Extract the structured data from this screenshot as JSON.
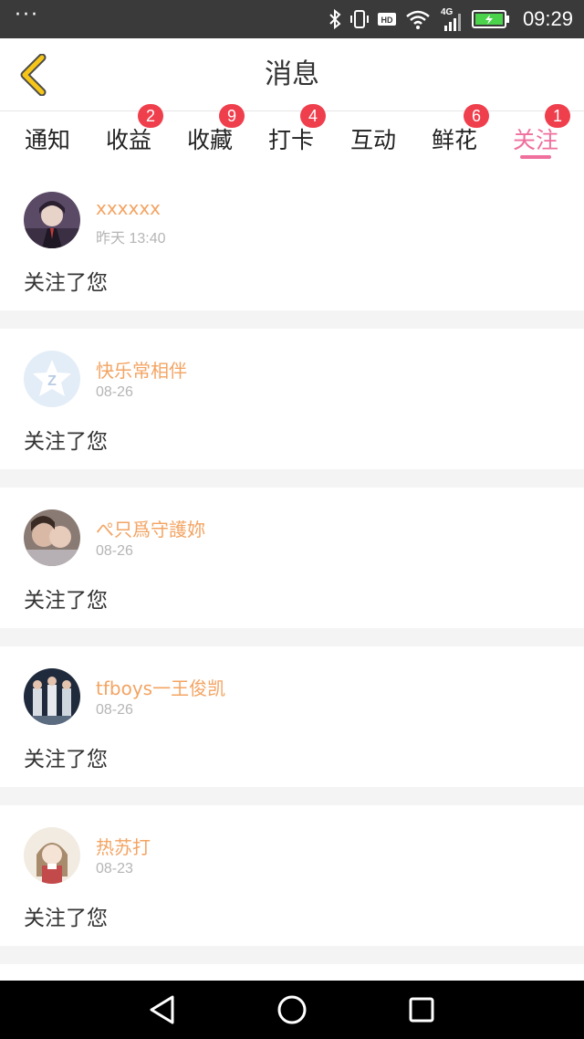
{
  "status_bar": {
    "left_icon": "more-dots-icon",
    "left_glyph": "···",
    "icons": [
      "bluetooth-icon",
      "vibrate-icon",
      "hd-icon",
      "wifi-icon",
      "signal-4g-icon",
      "battery-charging-icon"
    ],
    "network_label": "4G",
    "hd_label": "HD",
    "time": "09:29"
  },
  "header": {
    "title": "消息",
    "back_icon": "chevron-left-icon",
    "accent_color": "#f5c518"
  },
  "tabs": [
    {
      "label": "通知",
      "badge": ""
    },
    {
      "label": "收益",
      "badge": "2"
    },
    {
      "label": "收藏",
      "badge": "9"
    },
    {
      "label": "打卡",
      "badge": "4"
    },
    {
      "label": "互动",
      "badge": ""
    },
    {
      "label": "鲜花",
      "badge": "6"
    },
    {
      "label": "关注",
      "badge": "1",
      "active": true
    }
  ],
  "colors": {
    "active_tab": "#ef6f9d",
    "badge": "#ef3e4c",
    "username": "#f3a463",
    "timestamp": "#b5b5b5"
  },
  "notifications": [
    {
      "username": "xxxxxx",
      "time": "昨天 13:40",
      "message": "关注了您",
      "avatar": "anime-boy-avatar"
    },
    {
      "username": "快乐常相伴",
      "time": "08-26",
      "message": "关注了您",
      "avatar": "qq-default-avatar"
    },
    {
      "username": "ぺ只爲守護妳",
      "time": "08-26",
      "message": "关注了您",
      "avatar": "couple-photo-avatar"
    },
    {
      "username": "tfboys一王俊凯",
      "time": "08-26",
      "message": "关注了您",
      "avatar": "group-photo-avatar"
    },
    {
      "username": "热苏打",
      "time": "08-23",
      "message": "关注了您",
      "avatar": "anime-girl-avatar"
    }
  ],
  "system_nav": [
    "back-triangle-icon",
    "home-circle-icon",
    "recents-square-icon"
  ]
}
